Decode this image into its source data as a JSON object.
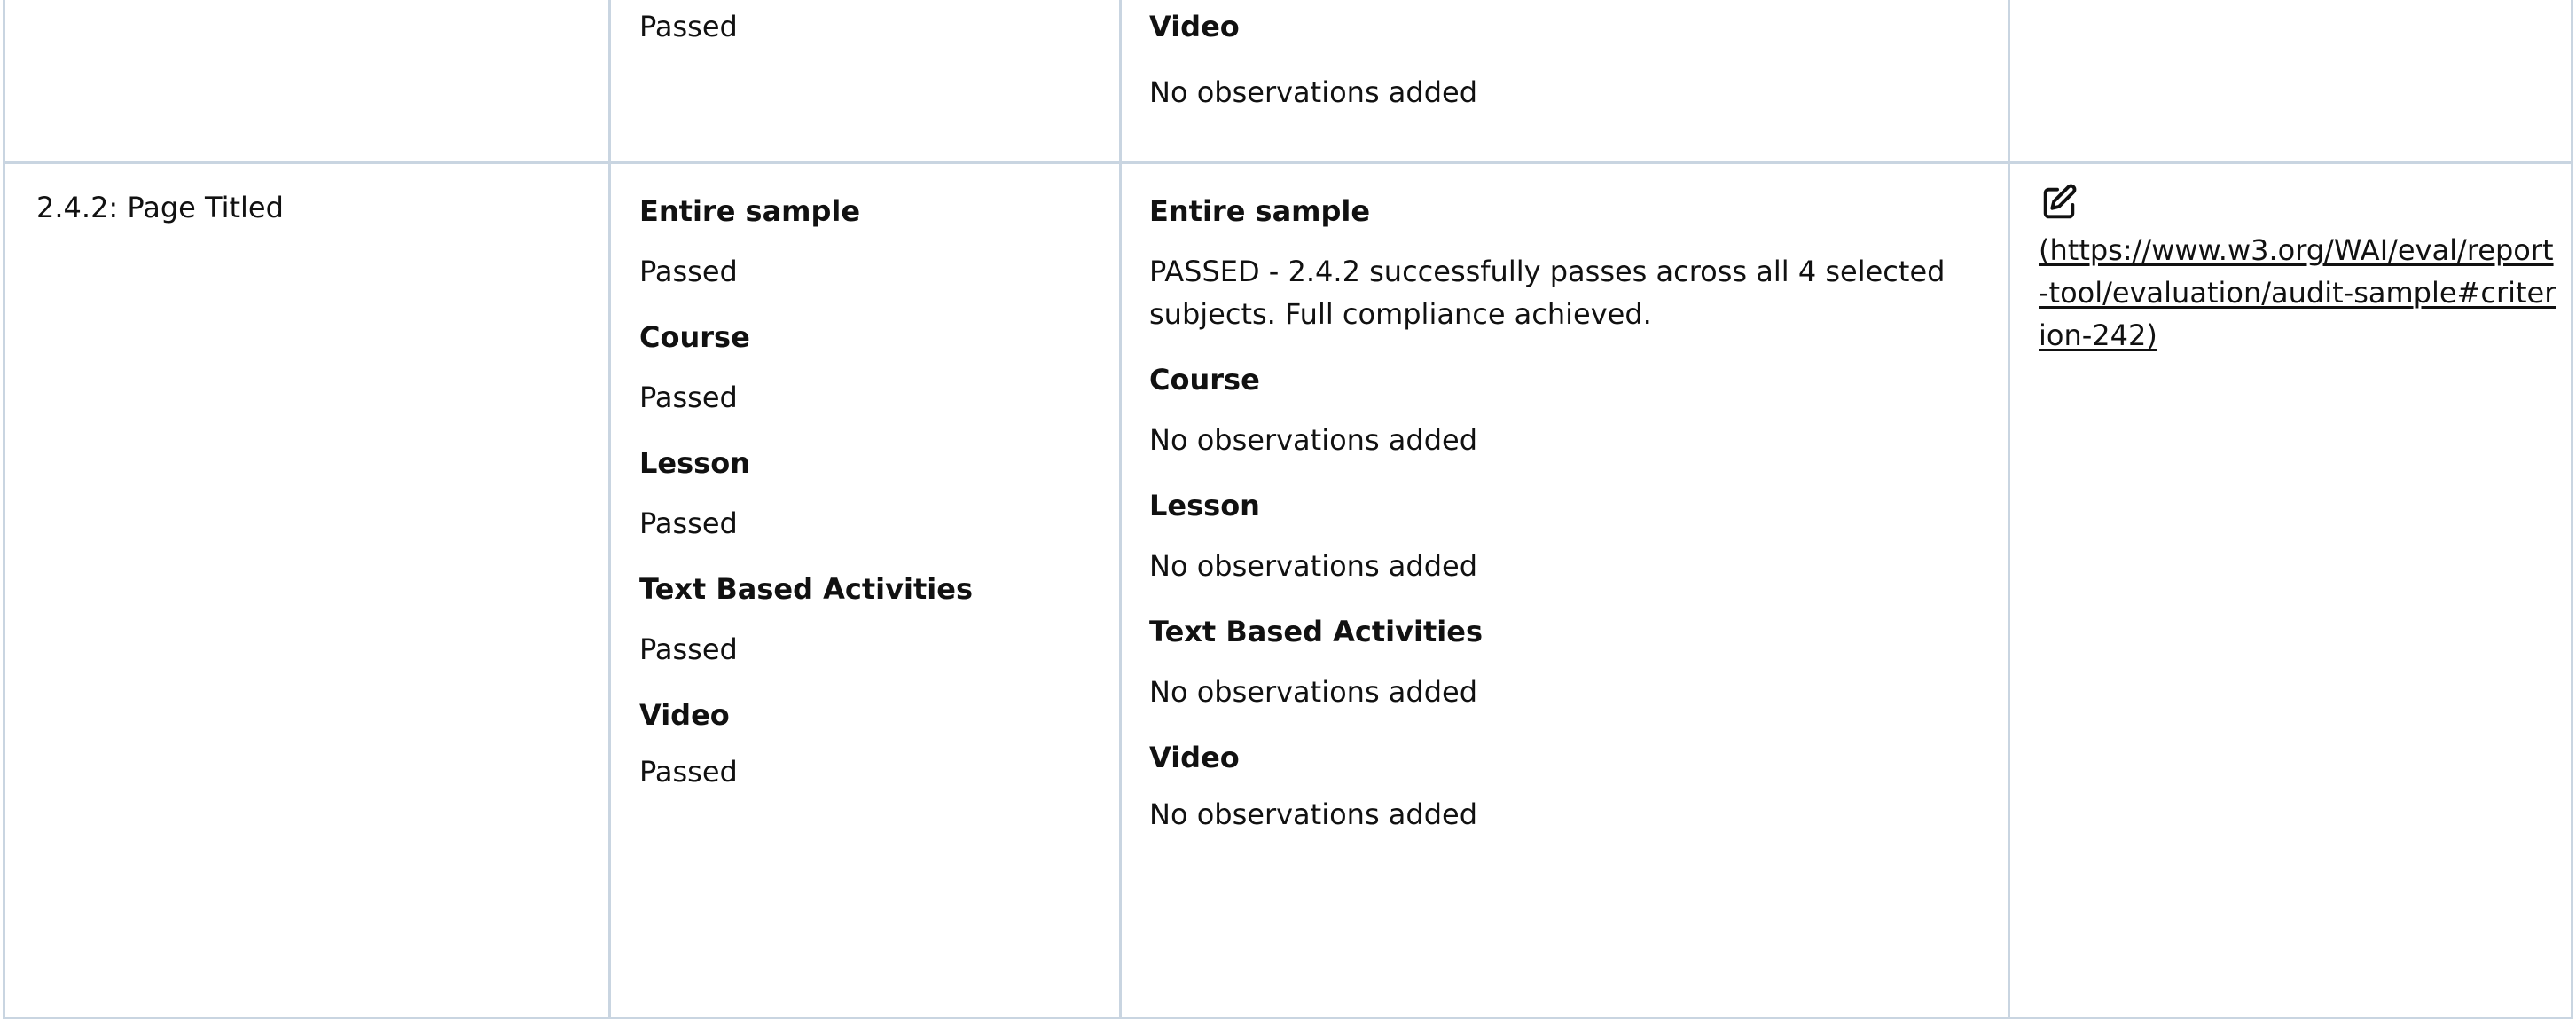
{
  "top_row": {
    "result_status": "Passed",
    "obs_label": "Video",
    "obs_text": "No observations added"
  },
  "row": {
    "criterion": "2.4.2: Page Titled",
    "results": [
      {
        "label": "Entire sample",
        "value": "Passed"
      },
      {
        "label": "Course",
        "value": "Passed"
      },
      {
        "label": "Lesson",
        "value": "Passed"
      },
      {
        "label": "Text Based Activities",
        "value": "Passed"
      },
      {
        "label": "Video",
        "value": "Passed"
      }
    ],
    "observations": [
      {
        "label": "Entire sample",
        "text": "PASSED - 2.4.2 successfully passes across all 4 selected subjects. Full compliance achieved."
      },
      {
        "label": "Course",
        "text": "No observations added"
      },
      {
        "label": "Lesson",
        "text": "No observations added"
      },
      {
        "label": "Text Based Activities",
        "text": "No observations added"
      },
      {
        "label": "Video",
        "text": "No observations added"
      }
    ],
    "edit_icon": "edit-icon",
    "link_text": "(https://www.w3.org/WAI/eval/report-tool/evaluation/audit-sample#criterion-242)"
  }
}
